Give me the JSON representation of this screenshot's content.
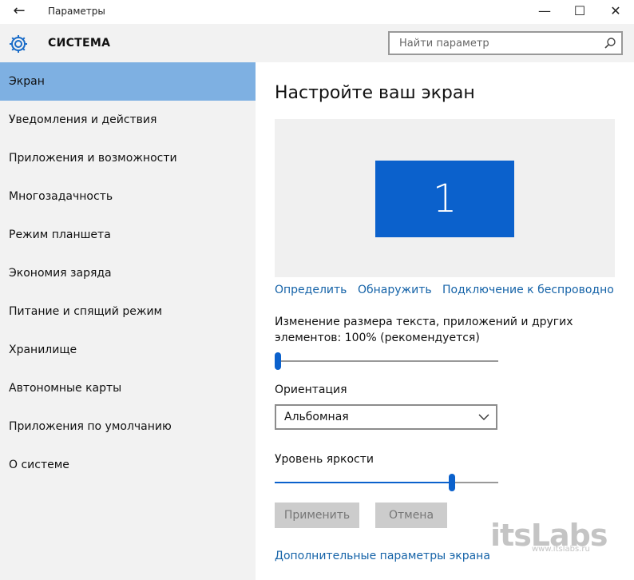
{
  "window": {
    "title": "Параметры",
    "back_glyph": "←",
    "minimize_glyph": "—",
    "maximize_glyph": "☐",
    "close_glyph": "✕"
  },
  "header": {
    "section_title": "СИСТЕМА",
    "search_placeholder": "Найти параметр"
  },
  "sidebar": {
    "items": [
      {
        "label": "Экран",
        "selected": true
      },
      {
        "label": "Уведомления и действия"
      },
      {
        "label": "Приложения и возможности"
      },
      {
        "label": "Многозадачность"
      },
      {
        "label": "Режим планшета"
      },
      {
        "label": "Экономия заряда"
      },
      {
        "label": "Питание и спящий режим"
      },
      {
        "label": "Хранилище"
      },
      {
        "label": "Автономные карты"
      },
      {
        "label": "Приложения по умолчанию"
      },
      {
        "label": "О системе"
      }
    ]
  },
  "main": {
    "heading": "Настройте ваш экран",
    "monitor_number": "1",
    "links": {
      "identify": "Определить",
      "detect": "Обнаружить",
      "wireless": "Подключение к беспроводном"
    },
    "scale": {
      "label_line1": "Изменение размера текста, приложений и других",
      "label_line2": "элементов: 100% (рекомендуется)",
      "level": 0
    },
    "orientation": {
      "label": "Ориентация",
      "value": "Альбомная"
    },
    "brightness": {
      "label": "Уровень яркости",
      "level": 0.8
    },
    "buttons": {
      "apply": "Применить",
      "cancel": "Отмена"
    },
    "advanced_link": "Дополнительные параметры экрана"
  },
  "watermark": {
    "logo": "itsLabs",
    "url": "www.itslabs.ru"
  },
  "colors": {
    "accent": "#0b61cc",
    "selected_nav": "#7eb0e2",
    "link": "#1563a8"
  }
}
